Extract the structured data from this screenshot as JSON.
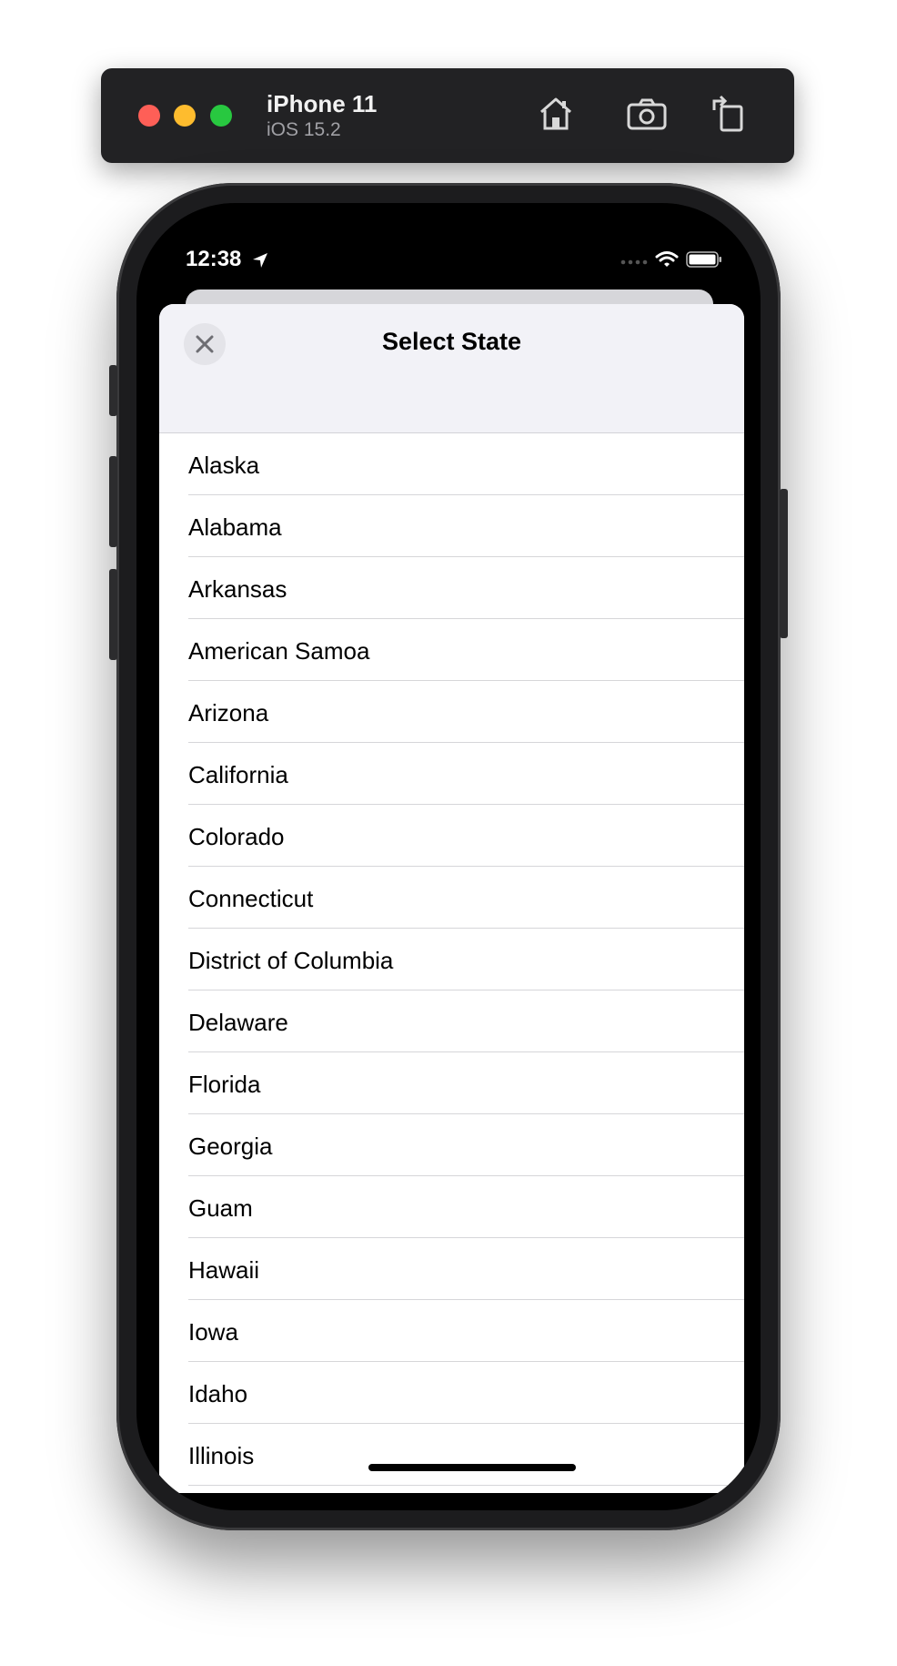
{
  "simulator": {
    "device_name": "iPhone 11",
    "os_version": "iOS 15.2",
    "toolbar_icons": [
      "home-icon",
      "screenshot-icon",
      "rotate-icon"
    ],
    "window_controls": [
      "close",
      "minimize",
      "zoom"
    ]
  },
  "status_bar": {
    "time": "12:38",
    "icons": [
      "location-arrow-icon",
      "signal-icon",
      "wifi-icon",
      "battery-icon"
    ]
  },
  "sheet": {
    "title": "Select State",
    "close_icon": "close-icon",
    "states": [
      "Alaska",
      "Alabama",
      "Arkansas",
      "American Samoa",
      "Arizona",
      "California",
      "Colorado",
      "Connecticut",
      "District of Columbia",
      "Delaware",
      "Florida",
      "Georgia",
      "Guam",
      "Hawaii",
      "Iowa",
      "Idaho",
      "Illinois"
    ]
  },
  "colors": {
    "header_bg": "#f2f2f7",
    "toolbar_bg": "#222224",
    "red": "#fe5f57",
    "yellow": "#febc2e",
    "green": "#28c840"
  }
}
